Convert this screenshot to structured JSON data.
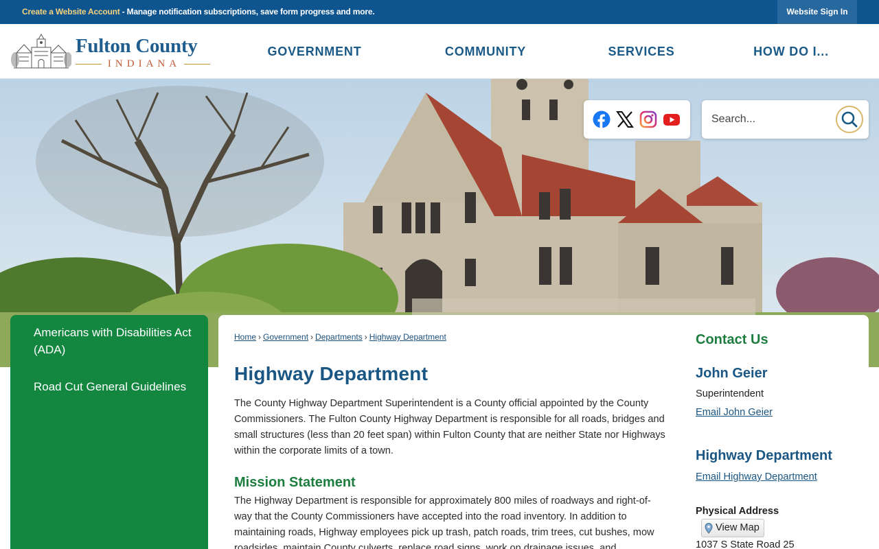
{
  "top_bar": {
    "create_account": "Create a Website Account",
    "message": " - Manage notification subscriptions, save form progress and more.",
    "sign_in": "Website Sign In"
  },
  "logo": {
    "name": "Fulton County",
    "state": "INDIANA"
  },
  "nav": {
    "government": "GOVERNMENT",
    "community": "COMMUNITY",
    "services": "SERVICES",
    "how_do_i": "HOW DO I..."
  },
  "social": [
    "facebook-icon",
    "x-twitter-icon",
    "instagram-icon",
    "youtube-icon"
  ],
  "search": {
    "placeholder": "Search..."
  },
  "sidebar": {
    "items": [
      {
        "label": "Americans with Disabilities Act (ADA)"
      },
      {
        "label": "Road Cut General Guidelines"
      }
    ]
  },
  "breadcrumb": [
    "Home",
    "Government",
    "Departments",
    "Highway Department"
  ],
  "page": {
    "title": "Highway Department",
    "intro": "The County Highway Department Superintendent is a County official appointed by the County Commissioners. The Fulton County Highway Department is responsible for all roads, bridges and small structures (less than 20 feet span) within Fulton County that are neither State nor Highways within the corporate limits of a town.",
    "mission_title": "Mission Statement",
    "mission_text": "The Highway Department is responsible for approximately 800 miles of roadways and right-of-way that the County Commissioners have accepted into the road inventory. In addition to maintaining roads, Highway employees pick up trash, patch roads, trim trees, cut bushes, mow roadsides, maintain County culverts, replace road signs, work on drainage issues, and"
  },
  "contact": {
    "heading": "Contact Us",
    "person": "John Geier",
    "role": "Superintendent",
    "email_person": "Email John Geier",
    "department": "Highway Department",
    "email_department": "Email Highway Department",
    "address_label": "Physical Address",
    "view_map": "View Map",
    "street": "1037 S State Road 25"
  },
  "colors": {
    "top_bar": "#0e5590",
    "nav_text": "#1b5a86",
    "sidebar": "#138640",
    "heading_blue": "#1a5683",
    "heading_green": "#1c7d3f"
  }
}
